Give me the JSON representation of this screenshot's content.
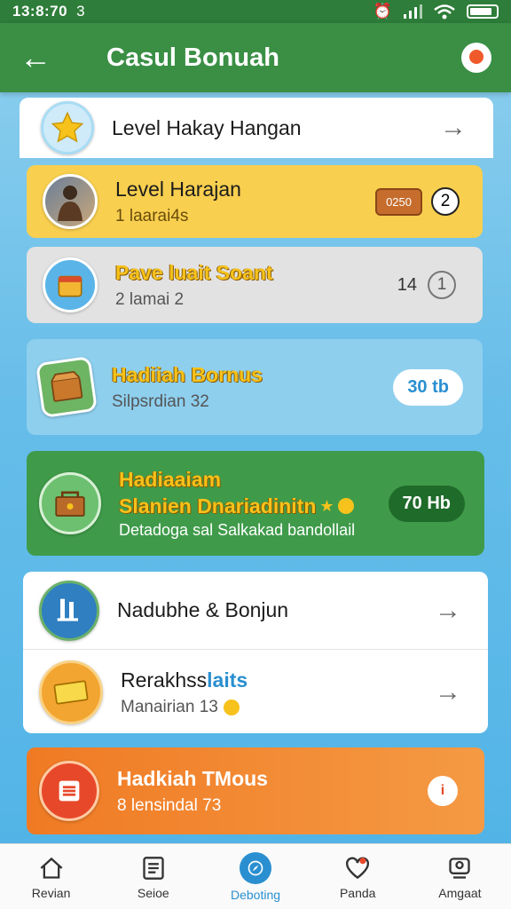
{
  "status": {
    "time": "13:8:70",
    "extra": "3"
  },
  "header": {
    "title": "Casul Bonuah"
  },
  "items": [
    {
      "title": "Level Hakay Hangan"
    },
    {
      "title": "Level Harajan",
      "subtitle": "1 laarai4s",
      "chip": "0250",
      "count": "2"
    },
    {
      "title": "Pave luait Soant",
      "subtitle": "2 lamai 2",
      "number": "14",
      "count": "1"
    },
    {
      "title": "Hadiiah Bornus",
      "subtitle": "Silpsrdian 32",
      "pill": "30 tb"
    },
    {
      "title": "Hadiaaiam",
      "subtitle": "Slanien Dnariadinitn",
      "desc": "Detadoga sal Salkakad bandollail",
      "pill": "70 Hb"
    },
    {
      "title": "Nadubhe & Bonjun"
    },
    {
      "title_a": "Rerakhss",
      "title_b": "laits",
      "subtitle": "Manairian 13"
    },
    {
      "title": "Hadkiah TMous",
      "subtitle": "8 lensindal 73"
    }
  ],
  "nav": [
    {
      "label": "Revian",
      "icon": "home-icon"
    },
    {
      "label": "Seioe",
      "icon": "list-icon"
    },
    {
      "label": "Deboting",
      "icon": "compass-icon"
    },
    {
      "label": "Panda",
      "icon": "heart-icon"
    },
    {
      "label": "Amgaat",
      "icon": "profile-icon"
    }
  ],
  "colors": {
    "green": "#3a8f45",
    "yellow": "#f8cf4f",
    "blue": "#8ecfee",
    "orange": "#f07a24"
  }
}
